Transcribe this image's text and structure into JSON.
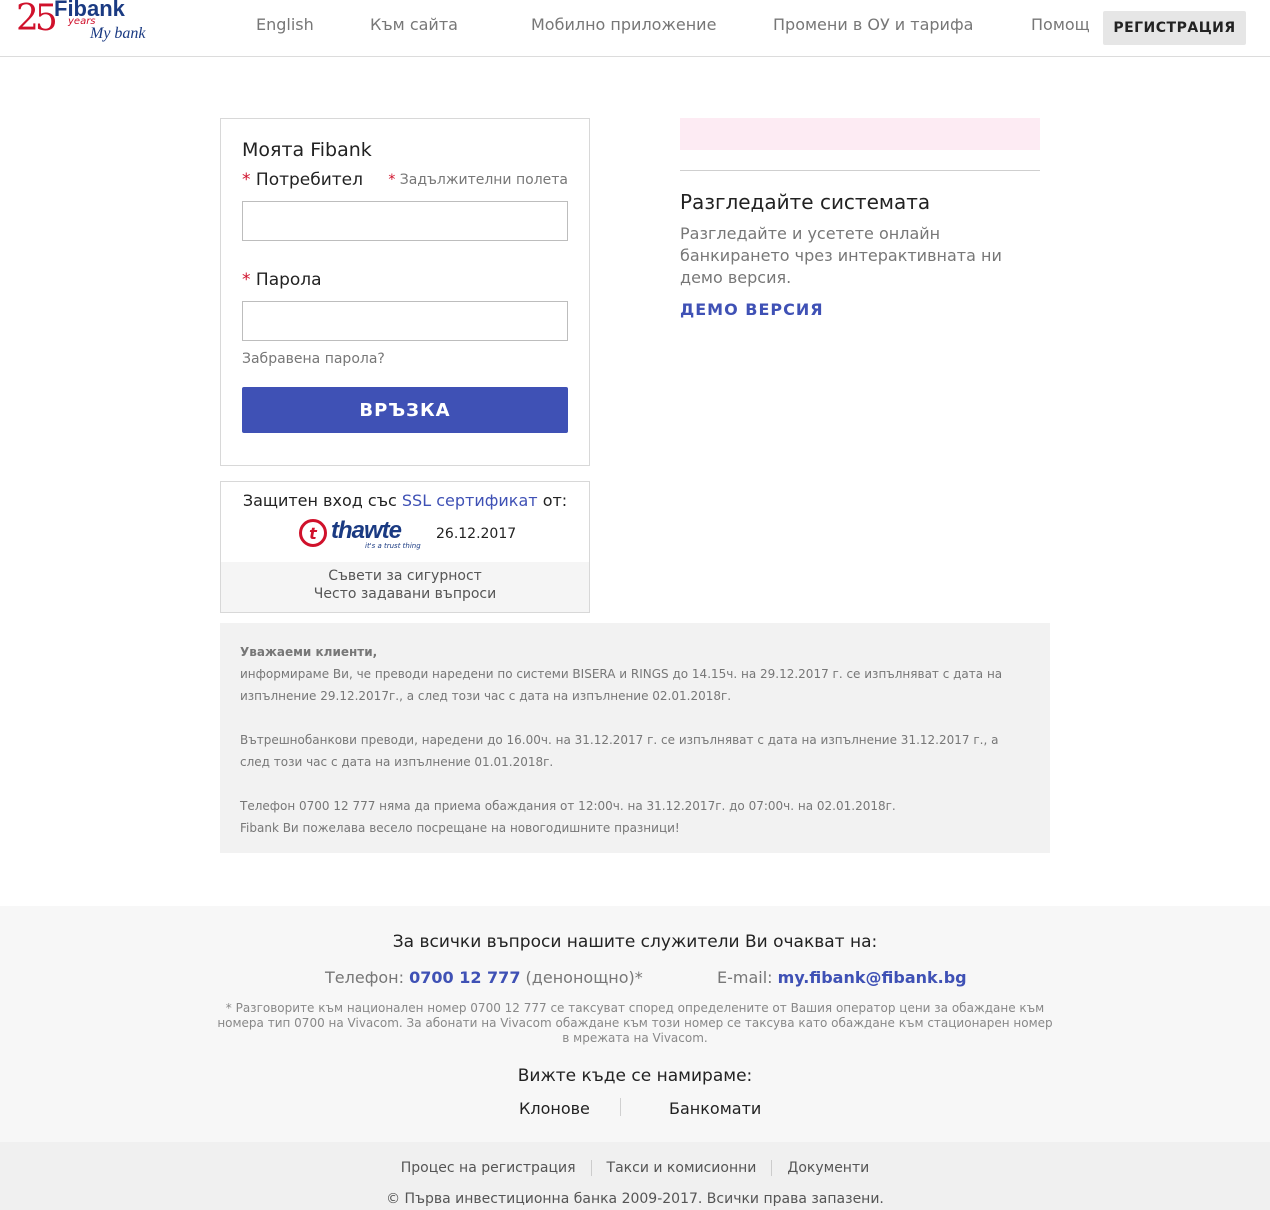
{
  "header": {
    "logo": {
      "number": "25",
      "years": "years",
      "brand": "Fibank",
      "sub": "My bank"
    },
    "nav": [
      "English",
      "Към сайта",
      "Мобилно приложение",
      "Промени в ОУ и тарифа",
      "Помощ"
    ],
    "register_label": "РЕГИСТРАЦИЯ"
  },
  "login": {
    "title": "Моята Fibank",
    "required_mark": "*",
    "user_label": "Потребител",
    "required_note": "Задължителни полета",
    "user_value": "",
    "password_label": "Парола",
    "password_value": "",
    "forgot_label": "Забравена парола?",
    "submit_label": "ВРЪЗКА"
  },
  "ssl": {
    "prefix": "Защитен вход със",
    "link": "SSL сертификат",
    "suffix": "от:",
    "provider": "thawte",
    "provider_tag": "it's a trust thing",
    "date": "26.12.2017",
    "security_tips": "Съвети за сигурност",
    "faq": "Често задавани въпроси"
  },
  "explore": {
    "title": "Разгледайте системата",
    "text": "Разгледайте и усетете онлайн банкирането чрез интерактивната ни демо версия.",
    "demo_label": "ДЕМО ВЕРСИЯ"
  },
  "notice": {
    "greeting": "Уважаеми клиенти,",
    "p1": "информираме Ви, че преводи наредени по системи BISERA и RINGS до 14.15ч. на 29.12.2017 г. се изпълняват с дата на изпълнение 29.12.2017г., а след този час с дата на изпълнение 02.01.2018г.",
    "p2": "Вътрешнобанкови преводи, наредени до 16.00ч. на 31.12.2017 г. се изпълняват с дата на изпълнение 31.12.2017 г., а след този час с дата на изпълнение 01.01.2018г.",
    "p3": "Телефон 0700 12 777 няма да приема обаждания от 12:00ч. на 31.12.2017г. до 07:00ч. на 02.01.2018г.",
    "p4": "Fibank Ви пожелава весело посрещане на новогодишните празници!"
  },
  "footer": {
    "question": "За всички въпроси нашите служители Ви очакват на:",
    "phone_label": "Телефон:",
    "phone": "0700 12 777",
    "phone_suffix": "(денонощно)*",
    "email_label": "E-mail:",
    "email": "my.fibank@fibank.bg",
    "note": "* Разговорите към национален номер 0700 12 777 се таксуват според определените от Вашия оператор цени за обаждане към номера тип 0700 на Vivacom. За абонати на Vivacom обаждане към този номер се таксува като обаждане към стационарен номер в мрежата на Vivacom.",
    "where": "Вижте къде се намираме:",
    "branches": "Клонове",
    "atms": "Банкомати"
  },
  "bottom": {
    "links": [
      "Процес на регистрация",
      "Такси и комисионни",
      "Документи"
    ],
    "copyright": "© Първа инвестиционна банка 2009-2017. Всички права запазени."
  },
  "colors": {
    "brand_blue": "#3f51b5",
    "brand_red": "#d0112b",
    "logo_navy": "#1a3a82"
  }
}
